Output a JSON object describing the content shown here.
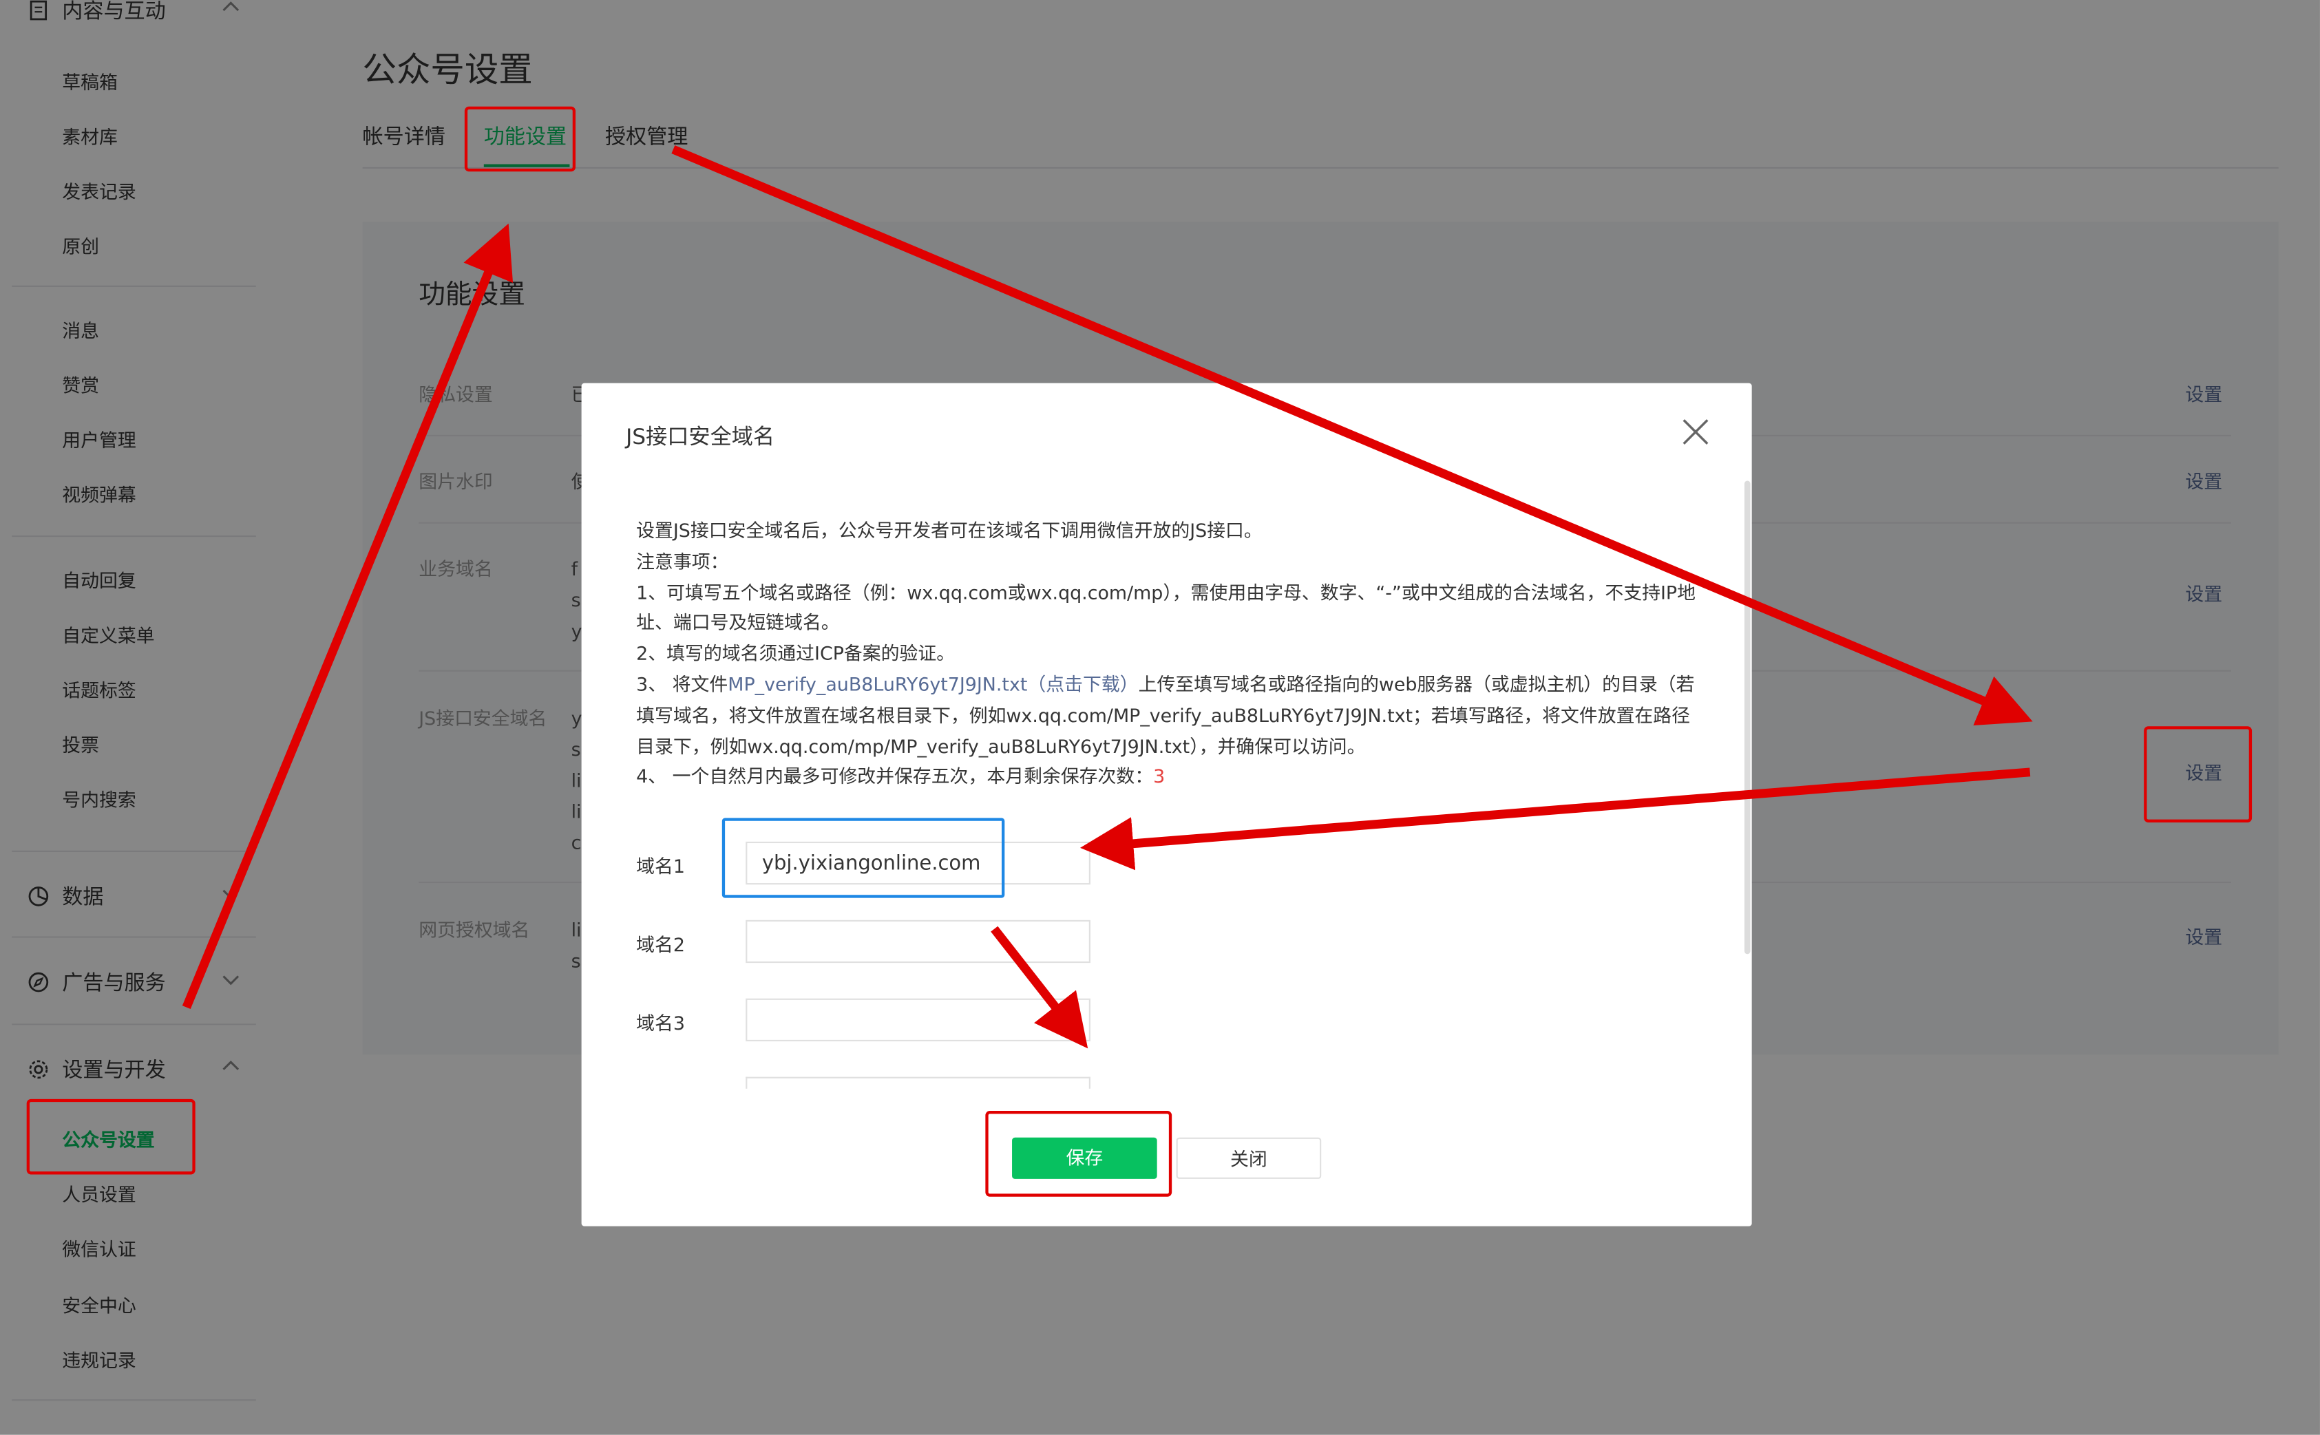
{
  "sidebar": {
    "group_content": "内容与互动",
    "content_items": [
      "草稿箱",
      "素材库",
      "发表记录",
      "原创"
    ],
    "interact_items": [
      "消息",
      "赞赏",
      "用户管理",
      "视频弹幕"
    ],
    "func_items": [
      "自动回复",
      "自定义菜单",
      "话题标签",
      "投票",
      "号内搜索"
    ],
    "group_data": "数据",
    "group_ads": "广告与服务",
    "group_settings": "设置与开发",
    "settings_items": [
      "公众号设置",
      "人员设置",
      "微信认证",
      "安全中心",
      "违规记录"
    ]
  },
  "page": {
    "title": "公众号设置",
    "tabs": [
      "帐号详情",
      "功能设置",
      "授权管理"
    ],
    "section_title": "功能设置",
    "rows": [
      {
        "label": "隐私设置",
        "action": "设置"
      },
      {
        "label": "图片水印",
        "action": "设置"
      },
      {
        "label": "业务域名",
        "action": "设置"
      },
      {
        "label": "JS接口安全域名",
        "action": "设置"
      },
      {
        "label": "网页授权域名",
        "action": "设置"
      }
    ]
  },
  "dialog": {
    "title": "JS接口安全域名",
    "intro": "设置JS接口安全域名后，公众号开发者可在该域名下调用微信开放的JS接口。",
    "notes_heading": "注意事项：",
    "note1": "1、可填写五个域名或路径（例：wx.qq.com或wx.qq.com/mp），需使用由字母、数字、“-”或中文组成的合法域名，不支持IP地址、端口号及短链域名。",
    "note2": "2、填写的域名须通过ICP备案的验证。",
    "note3_prefix": "3、 将文件",
    "note3_file": "MP_verify_auB8LuRY6yt7J9JN.txt",
    "note3_download": "（点击下载）",
    "note3_suffix": "上传至填写域名或路径指向的web服务器（或虚拟主机）的目录（若填写域名，将文件放置在域名根目录下，例如wx.qq.com/MP_verify_auB8LuRY6yt7J9JN.txt；若填写路径，将文件放置在路径目录下，例如wx.qq.com/mp/MP_verify_auB8LuRY6yt7J9JN.txt），并确保可以访问。",
    "note4_prefix": "4、 一个自然月内最多可修改并保存五次，本月剩余保存次数：",
    "note4_count": "3",
    "domain_labels": [
      "域名1",
      "域名2",
      "域名3"
    ],
    "domain_values": [
      "ybj.yixiangonline.com",
      "",
      ""
    ],
    "save_label": "保存",
    "close_label": "关闭"
  },
  "colors": {
    "accent": "#07c160",
    "link": "#576b95",
    "annotation": "#e00000",
    "focus": "#1e88e5"
  }
}
